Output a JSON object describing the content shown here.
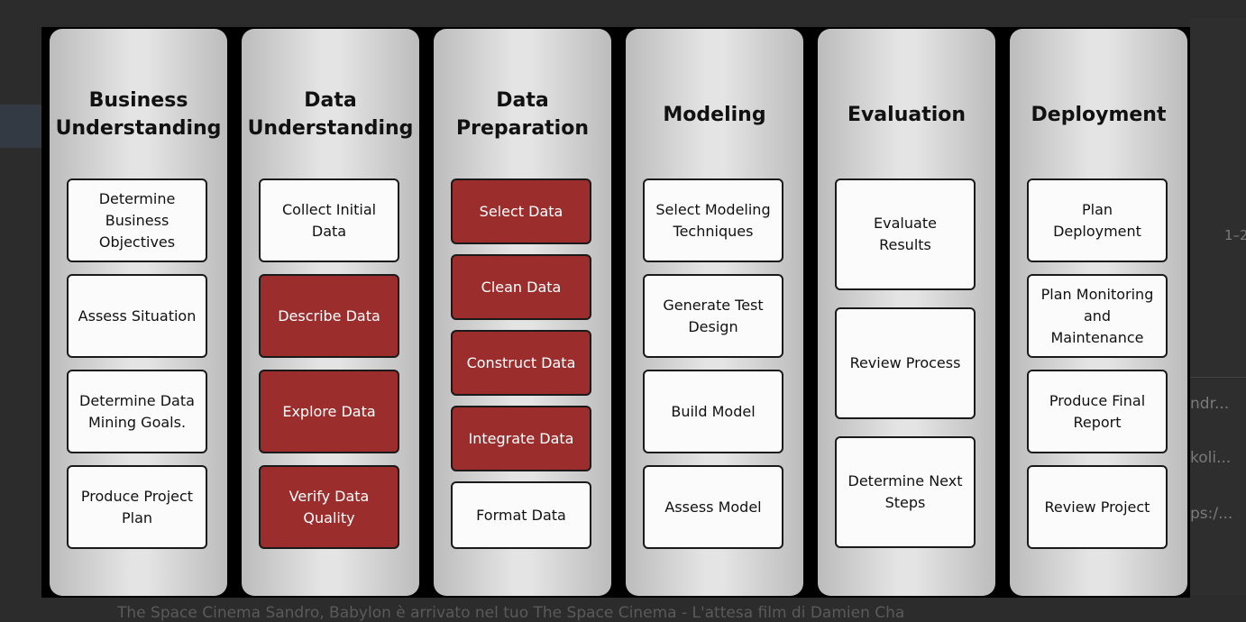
{
  "background": {
    "side_texts": [
      "1–2",
      "ndr...",
      "koli...",
      "ps:/..."
    ],
    "bottom_text": "The Space Cinema          Sandro, Babylon è arrivato nel tuo The Space Cinema - L'attesa film di Damien Cha"
  },
  "colors": {
    "highlight": "#9b2d2d",
    "box_border": "#1a1a1a",
    "box_fill": "#fbfbfb",
    "backdrop": "#000000"
  },
  "columns": [
    {
      "title": "Business\nUnderstanding",
      "tasks": [
        {
          "label": "Determine\nBusiness\nObjectives",
          "highlighted": false
        },
        {
          "label": "Assess Situation",
          "highlighted": false
        },
        {
          "label": "Determine Data\nMining Goals.",
          "highlighted": false
        },
        {
          "label": "Produce Project\nPlan",
          "highlighted": false
        }
      ]
    },
    {
      "title": "Data\nUnderstanding",
      "tasks": [
        {
          "label": "Collect Initial\nData",
          "highlighted": false
        },
        {
          "label": "Describe Data",
          "highlighted": true
        },
        {
          "label": "Explore Data",
          "highlighted": true
        },
        {
          "label": "Verify Data\nQuality",
          "highlighted": true
        }
      ]
    },
    {
      "title": "Data\nPreparation",
      "tasks": [
        {
          "label": "Select Data",
          "highlighted": true
        },
        {
          "label": "Clean Data",
          "highlighted": true
        },
        {
          "label": "Construct Data",
          "highlighted": true
        },
        {
          "label": "Integrate Data",
          "highlighted": true
        },
        {
          "label": "Format Data",
          "highlighted": false
        }
      ]
    },
    {
      "title": "Modeling",
      "tasks": [
        {
          "label": "Select Modeling\nTechniques",
          "highlighted": false
        },
        {
          "label": "Generate Test\nDesign",
          "highlighted": false
        },
        {
          "label": "Build Model",
          "highlighted": false
        },
        {
          "label": "Assess Model",
          "highlighted": false
        }
      ]
    },
    {
      "title": "Evaluation",
      "tasks": [
        {
          "label": "Evaluate\nResults",
          "highlighted": false
        },
        {
          "label": "Review Process",
          "highlighted": false
        },
        {
          "label": "Determine Next\nSteps",
          "highlighted": false
        }
      ]
    },
    {
      "title": "Deployment",
      "tasks": [
        {
          "label": "Plan\nDeployment",
          "highlighted": false
        },
        {
          "label": "Plan Monitoring\nand\nMaintenance",
          "highlighted": false
        },
        {
          "label": "Produce Final\nReport",
          "highlighted": false
        },
        {
          "label": "Review Project",
          "highlighted": false
        }
      ]
    }
  ]
}
